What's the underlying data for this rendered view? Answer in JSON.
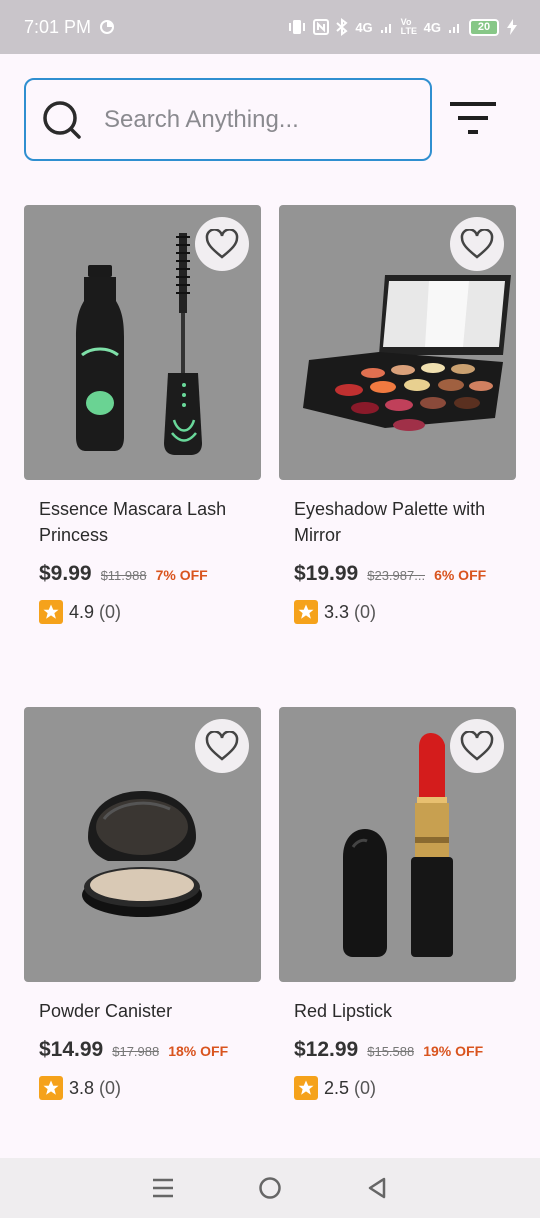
{
  "status_bar": {
    "time": "7:01 PM",
    "net1": "4G",
    "volte": "Vo LTE",
    "net2": "4G",
    "battery": "20"
  },
  "search": {
    "placeholder": "Search Anything..."
  },
  "products": [
    {
      "name": "Essence Mascara Lash Princess",
      "price": "$9.99",
      "old_price": "$11.988",
      "discount": "7% OFF",
      "rating": "4.9",
      "count": "(0)",
      "image": "mascara"
    },
    {
      "name": "Eyeshadow Palette with Mirror",
      "price": "$19.99",
      "old_price": "$23.987...",
      "discount": "6% OFF",
      "rating": "3.3",
      "count": "(0)",
      "image": "palette"
    },
    {
      "name": "Powder Canister",
      "price": "$14.99",
      "old_price": "$17.988",
      "discount": "18% OFF",
      "rating": "3.8",
      "count": "(0)",
      "image": "powder"
    },
    {
      "name": "Red Lipstick",
      "price": "$12.99",
      "old_price": "$15.588",
      "discount": "19% OFF",
      "rating": "2.5",
      "count": "(0)",
      "image": "lipstick"
    }
  ],
  "colors": {
    "accent": "#2f8fd0",
    "discount": "#d9541e",
    "star": "#f5a21b"
  }
}
